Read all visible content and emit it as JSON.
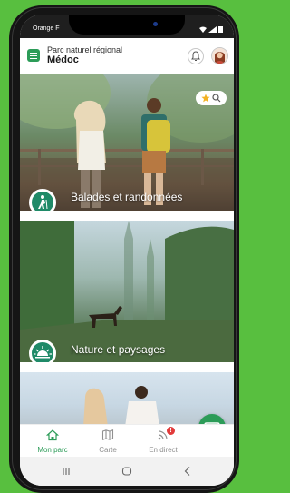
{
  "status_bar": {
    "carrier": "Orange F"
  },
  "header": {
    "subtitle": "Parc naturel régional",
    "title": "Médoc"
  },
  "icons": {
    "menu": "menu-icon",
    "bell": "bell-icon",
    "avatar": "avatar-icon",
    "star": "star-icon",
    "search": "search-icon",
    "hiker": "hiker-icon",
    "sunrise": "sunrise-icon",
    "chat": "chat-icon",
    "home": "home-icon",
    "map": "map-icon",
    "live": "live-signal-icon"
  },
  "cards": [
    {
      "title": "Balades et randonnées",
      "icon": "hiker-icon"
    },
    {
      "title": "Nature et paysages",
      "icon": "sunrise-icon"
    },
    {
      "title": ""
    }
  ],
  "tabs": [
    {
      "label": "Mon parc",
      "active": true
    },
    {
      "label": "Carte",
      "active": false
    },
    {
      "label": "En direct",
      "active": false,
      "badge": "!"
    }
  ],
  "colors": {
    "accent": "#2c9c58",
    "background": "#58bf3f",
    "badge": "#e23b3b"
  }
}
